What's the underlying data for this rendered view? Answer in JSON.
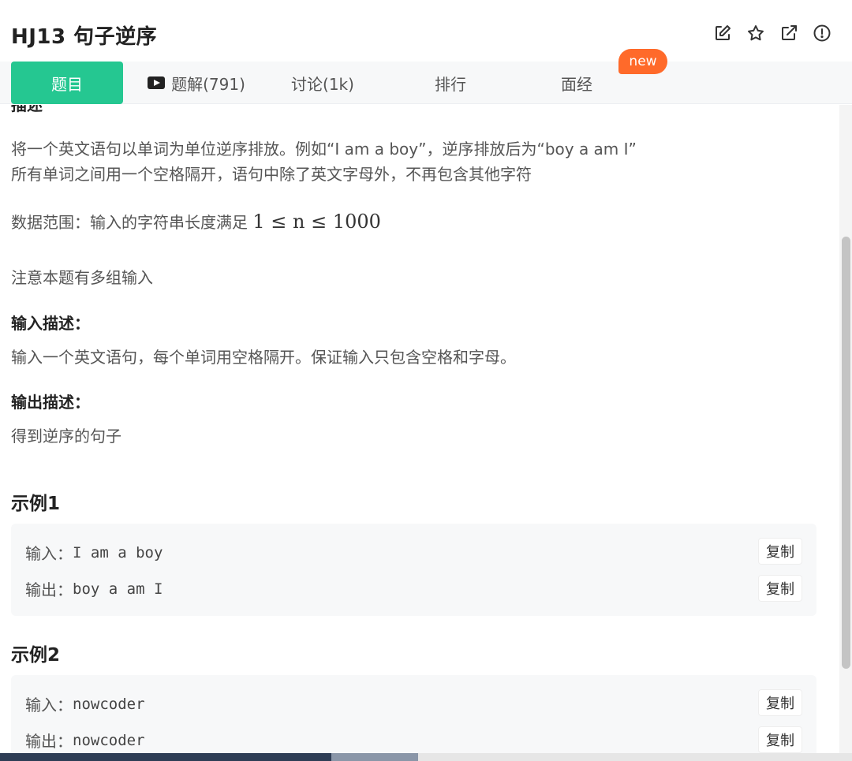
{
  "header": {
    "title": "HJ13  句子逆序",
    "icons": [
      "edit-icon",
      "star-icon",
      "external-link-icon",
      "report-icon"
    ]
  },
  "tabs": [
    {
      "label": "题目",
      "active": true
    },
    {
      "label": "题解(791)",
      "icon": "video-play-icon"
    },
    {
      "label": "讨论(1k)"
    },
    {
      "label": "排行"
    },
    {
      "label": "面经"
    }
  ],
  "new_badge": "new",
  "description": {
    "heading": "描述",
    "line1": "将一个英文语句以单词为单位逆序排放。例如“I am a boy”，逆序排放后为“boy a am I”",
    "line2": "所有单词之间用一个空格隔开，语句中除了英文字母外，不再包含其他字符",
    "range_label": "数据范围：输入的字符串长度满足",
    "range_math": "1 ≤ n ≤ 1000",
    "note": "注意本题有多组输入"
  },
  "input_desc": {
    "heading": "输入描述：",
    "text": "输入一个英文语句，每个单词用空格隔开。保证输入只包含空格和字母。"
  },
  "output_desc": {
    "heading": "输出描述：",
    "text": "得到逆序的句子"
  },
  "examples": [
    {
      "title": "示例1",
      "input_label": "输入：",
      "input": "I am a boy",
      "output_label": "输出：",
      "output": "boy a am I",
      "copy_label": "复制"
    },
    {
      "title": "示例2",
      "input_label": "输入：",
      "input": "nowcoder",
      "output_label": "输出：",
      "output": "nowcoder",
      "copy_label": "复制"
    }
  ],
  "colors": {
    "accent": "#25c791",
    "badge": "#ff6a2a"
  }
}
